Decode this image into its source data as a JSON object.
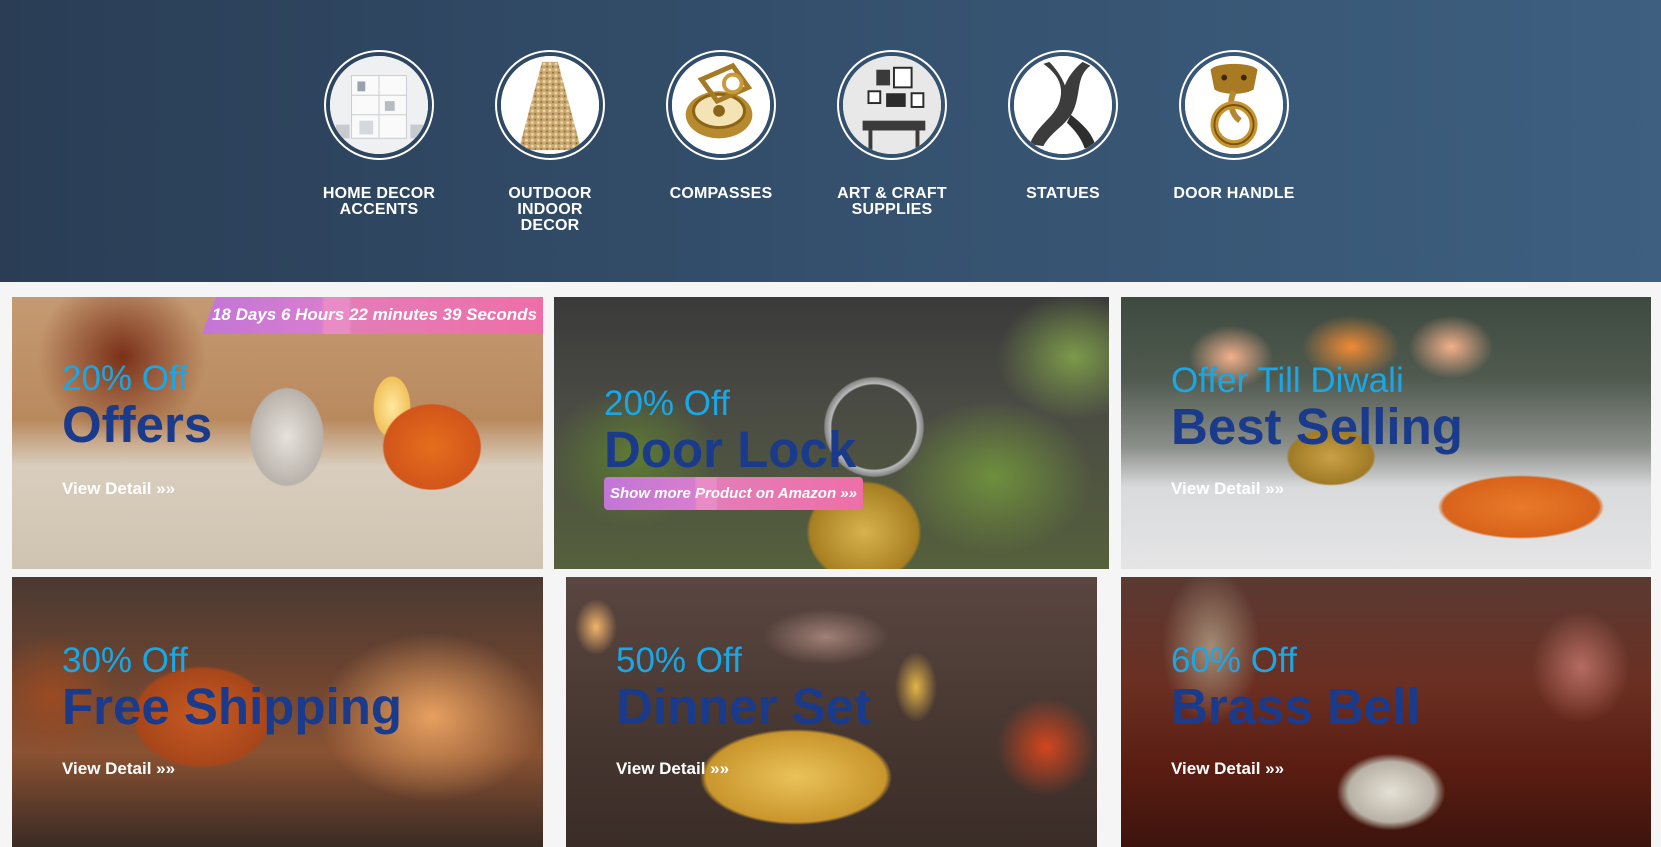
{
  "categories": [
    {
      "label": "HOME DECOR\nACCENTS",
      "icon": "shelf-interior-icon"
    },
    {
      "label": "OUTDOOR\nINDOOR\nDECOR",
      "icon": "glitter-cone-icon"
    },
    {
      "label": "COMPASSES",
      "icon": "brass-compass-icon"
    },
    {
      "label": "ART & CRAFT\nSUPPLIES",
      "icon": "wall-art-icon"
    },
    {
      "label": "STATUES",
      "icon": "abstract-statue-icon"
    },
    {
      "label": "DOOR HANDLE",
      "icon": "elephant-door-handle-icon"
    }
  ],
  "offers": [
    {
      "discount": "20% Off",
      "title": "Offers",
      "detail": "View Detail »»",
      "timer": "18 Days 6 Hours 22 minutes 39 Seconds"
    },
    {
      "discount": "20% Off",
      "title": "Door Lock",
      "button": "Show more Product on Amazon »»"
    },
    {
      "discount": "Offer Till Diwali",
      "title": "Best Selling",
      "detail": "View Detail »»"
    },
    {
      "discount": "30% Off",
      "title": "Free Shipping",
      "detail": "View Detail »»"
    },
    {
      "discount": "50% Off",
      "title": "Dinner Set",
      "detail": "View Detail »»"
    },
    {
      "discount": "60% Off",
      "title": "Brass Bell",
      "detail": "View Detail »»"
    }
  ],
  "colors": {
    "hero_start": "#2a3d55",
    "hero_end": "#3e5f80",
    "discount_text": "#19a7e5",
    "title_text": "#1a3a8c",
    "promo_pink": "#ee6fa7",
    "promo_purple": "#c276d6"
  }
}
